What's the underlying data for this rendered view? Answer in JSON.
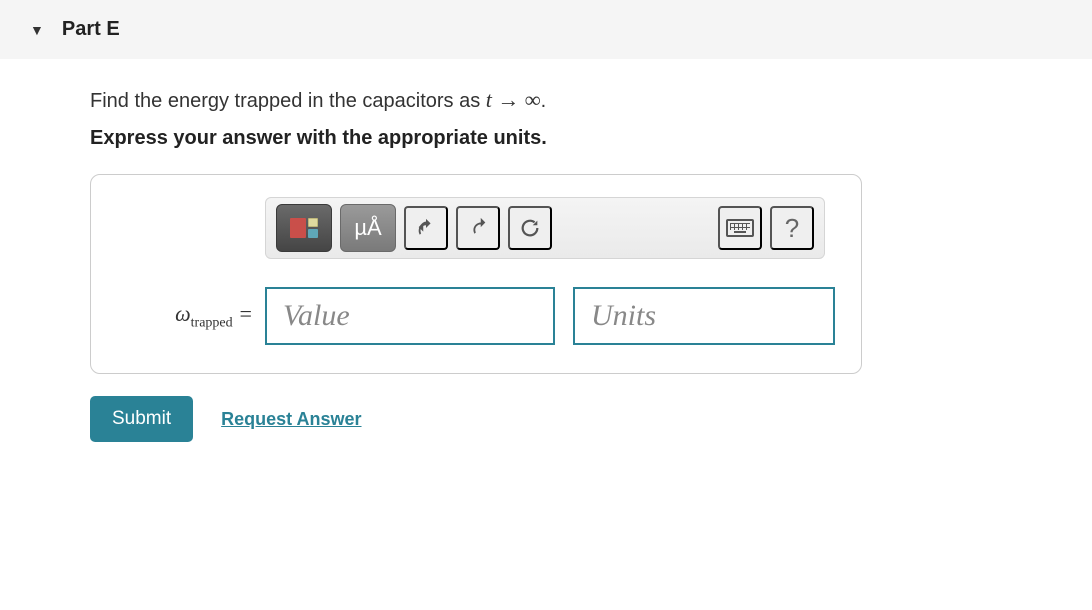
{
  "part": {
    "label": "Part E"
  },
  "prompt": {
    "prefix": "Find the energy trapped in the capacitors as ",
    "math": "t → ∞",
    "suffix": "."
  },
  "instruction": "Express your answer with the appropriate units.",
  "toolbar": {
    "units_button_label": "µÅ"
  },
  "answer": {
    "variable_symbol": "ω",
    "variable_subscript": "trapped",
    "equals": " =",
    "value_placeholder": "Value",
    "units_placeholder": "Units"
  },
  "actions": {
    "submit": "Submit",
    "request": "Request Answer"
  },
  "help": {
    "label": "?"
  }
}
